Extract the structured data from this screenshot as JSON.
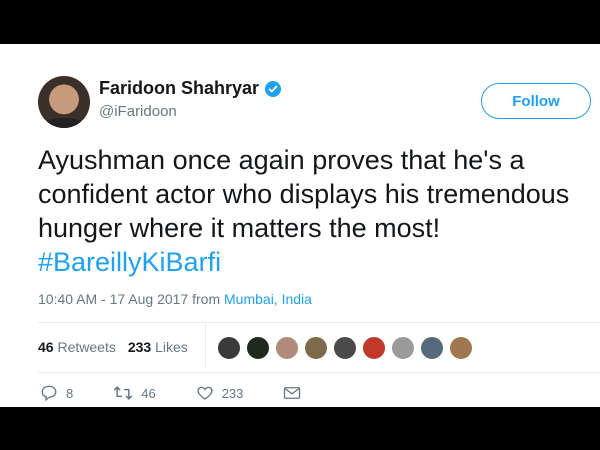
{
  "user": {
    "name": "Faridoon Shahryar",
    "handle": "@iFaridoon"
  },
  "follow_label": "Follow",
  "tweet": {
    "lines": [
      "Ayushman once again proves that he's a",
      "confident actor who displays his tremendous",
      "hunger where it matters the most!"
    ],
    "hashtag": "#BareillyKiBarfi"
  },
  "meta": {
    "time": "10:40 AM - 17 Aug 2017",
    "from": "from",
    "location": "Mumbai, India"
  },
  "stats": {
    "retweets_count": "46",
    "retweets_label": "Retweets",
    "likes_count": "233",
    "likes_label": "Likes"
  },
  "faces": [
    {
      "color": "#3a3a3a"
    },
    {
      "color": "#1f2a1f"
    },
    {
      "color": "#b08a7a"
    },
    {
      "color": "#7d6a4a"
    },
    {
      "color": "#4a4a4a"
    },
    {
      "color": "#c0392b"
    },
    {
      "color": "#9a9a9a"
    },
    {
      "color": "#556b7d"
    },
    {
      "color": "#a07850"
    }
  ],
  "actions": {
    "replies": "8",
    "retweets": "46",
    "likes": "233"
  },
  "colors": {
    "accent": "#1da1f2",
    "text": "#14171a",
    "muted": "#657786"
  }
}
